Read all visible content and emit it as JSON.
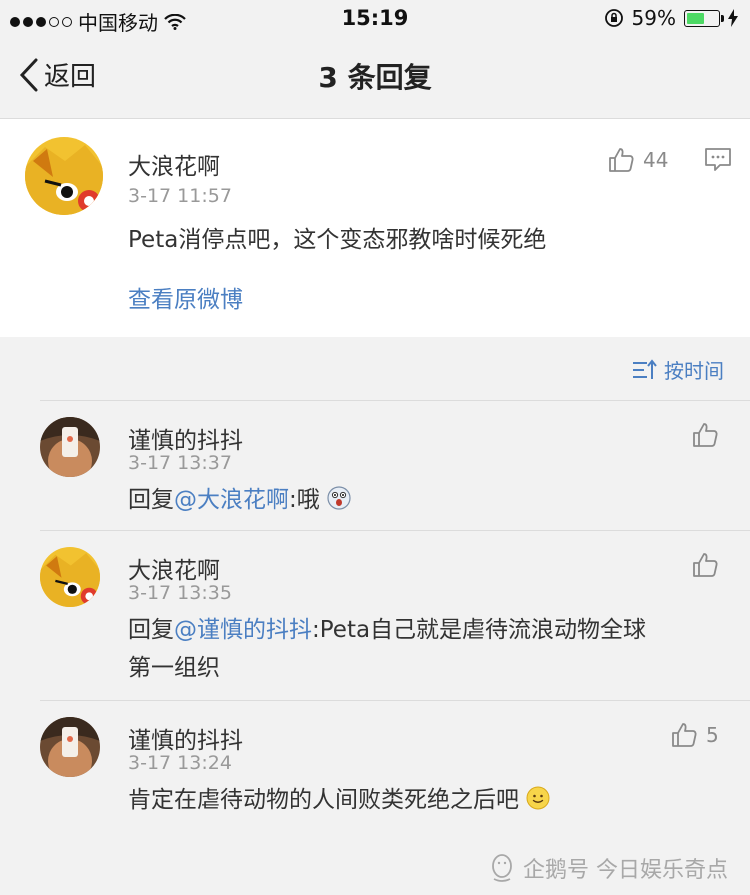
{
  "status_bar": {
    "carrier": "中国移动",
    "time": "15:19",
    "battery": "59%",
    "battery_level": 0.59
  },
  "nav": {
    "back_label": "返回",
    "title": "3 条回复"
  },
  "post": {
    "author": "大浪花啊",
    "time": "3-17 11:57",
    "likes": "44",
    "text": "Peta消停点吧，这个变态邪教啥时候死绝",
    "view_original": "查看原微博"
  },
  "sort_label": "按时间",
  "replies": [
    {
      "author": "谨慎的抖抖",
      "time": "3-17 13:37",
      "prefix": "回复",
      "mention": "@大浪花啊",
      "text": ":哦",
      "likes": ""
    },
    {
      "author": "大浪花啊",
      "time": "3-17 13:35",
      "prefix": "回复",
      "mention": "@谨慎的抖抖",
      "text": ":Peta自己就是虐待流浪动物全球",
      "text_line2": "第一组织",
      "likes": ""
    },
    {
      "author": "谨慎的抖抖",
      "time": "3-17 13:24",
      "text": "肯定在虐待动物的人间败类死绝之后吧",
      "likes": "5"
    }
  ],
  "watermark": "企鹅号 今日娱乐奇点",
  "colors": {
    "link": "#4b7fc2",
    "battery_fill": "#4cd964"
  }
}
